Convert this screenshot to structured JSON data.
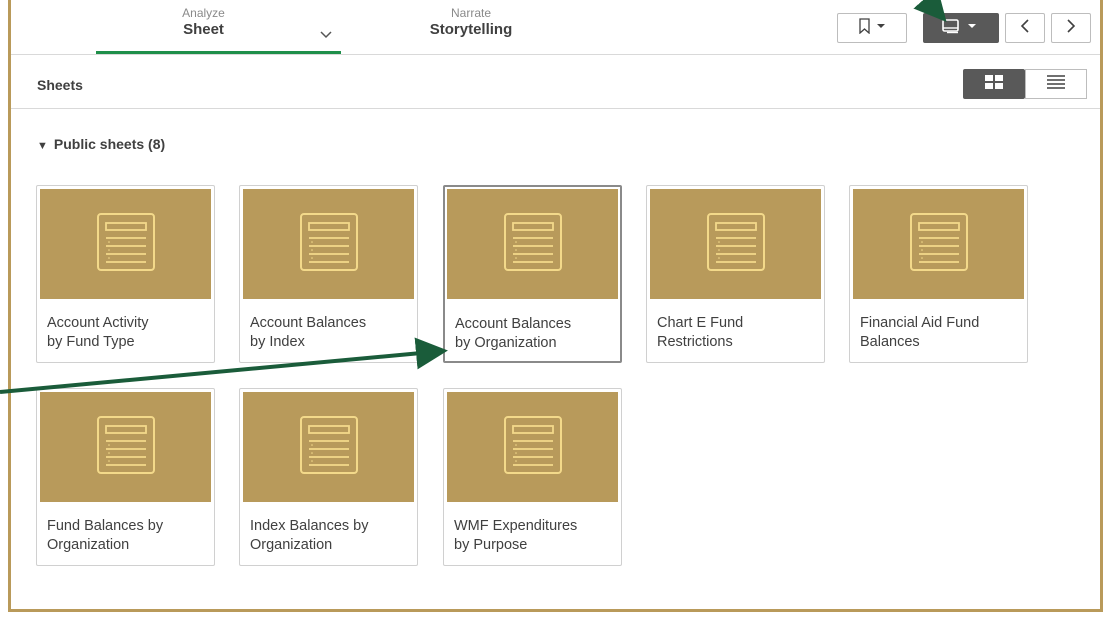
{
  "nav": {
    "analyze_small": "Analyze",
    "analyze_big": "Sheet",
    "narrate_small": "Narrate",
    "narrate_big": "Storytelling"
  },
  "icons": {
    "chevron": "chevron-down-icon",
    "bookmark": "bookmark-icon",
    "sheets": "sheets-icon",
    "prev": "chevron-left-icon",
    "next": "chevron-right-icon",
    "grid": "grid-view-icon",
    "list": "list-view-icon",
    "sheet_thumb": "sheet-document-icon"
  },
  "panel": {
    "title": "Sheets",
    "section": "Public sheets (8)"
  },
  "sheets": [
    {
      "line1": "Account Activity",
      "line2": "by Fund Type"
    },
    {
      "line1": "Account Balances",
      "line2": "by Index"
    },
    {
      "line1": "Account Balances",
      "line2": "by Organization"
    },
    {
      "line1": "Chart E Fund",
      "line2": "Restrictions"
    },
    {
      "line1": "Financial Aid Fund",
      "line2": "Balances"
    },
    {
      "line1": "Fund Balances by",
      "line2": "Organization"
    },
    {
      "line1": "Index Balances by",
      "line2": "Organization"
    },
    {
      "line1": "WMF Expenditures",
      "line2": "by Purpose"
    }
  ],
  "colors": {
    "frame": "#b99a5a",
    "thumbnail": "#b89a5b",
    "accent_green": "#1f8f4a",
    "annotation_arrow": "#1a5c3a"
  }
}
